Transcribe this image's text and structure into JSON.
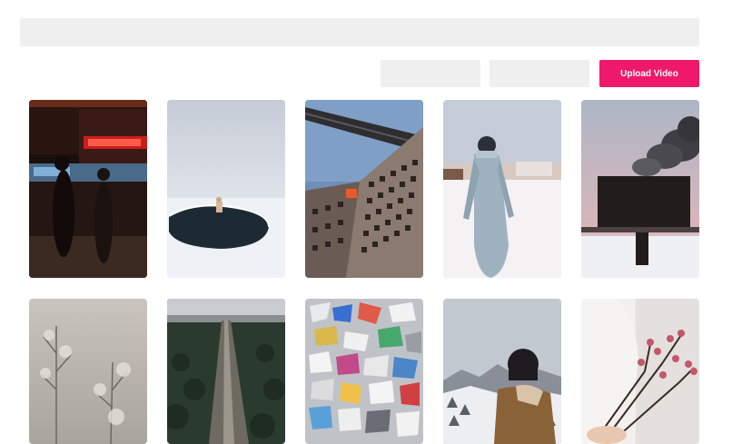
{
  "toolbar": {
    "upload_label": "Upload Video"
  },
  "gallery": {
    "items": [
      {
        "icon": "city-night-street-photo"
      },
      {
        "icon": "frozen-lake-photo"
      },
      {
        "icon": "skyscraper-bridge-photo"
      },
      {
        "icon": "snow-walker-photo"
      },
      {
        "icon": "smoke-billboard-photo"
      },
      {
        "icon": "frosted-plants-photo"
      },
      {
        "icon": "forest-road-photo"
      },
      {
        "icon": "paper-pile-photo"
      },
      {
        "icon": "woman-mountains-photo"
      },
      {
        "icon": "flowers-bouquet-photo"
      }
    ]
  },
  "colors": {
    "accent": "#f0186b",
    "placeholder_bg": "#efefef"
  }
}
